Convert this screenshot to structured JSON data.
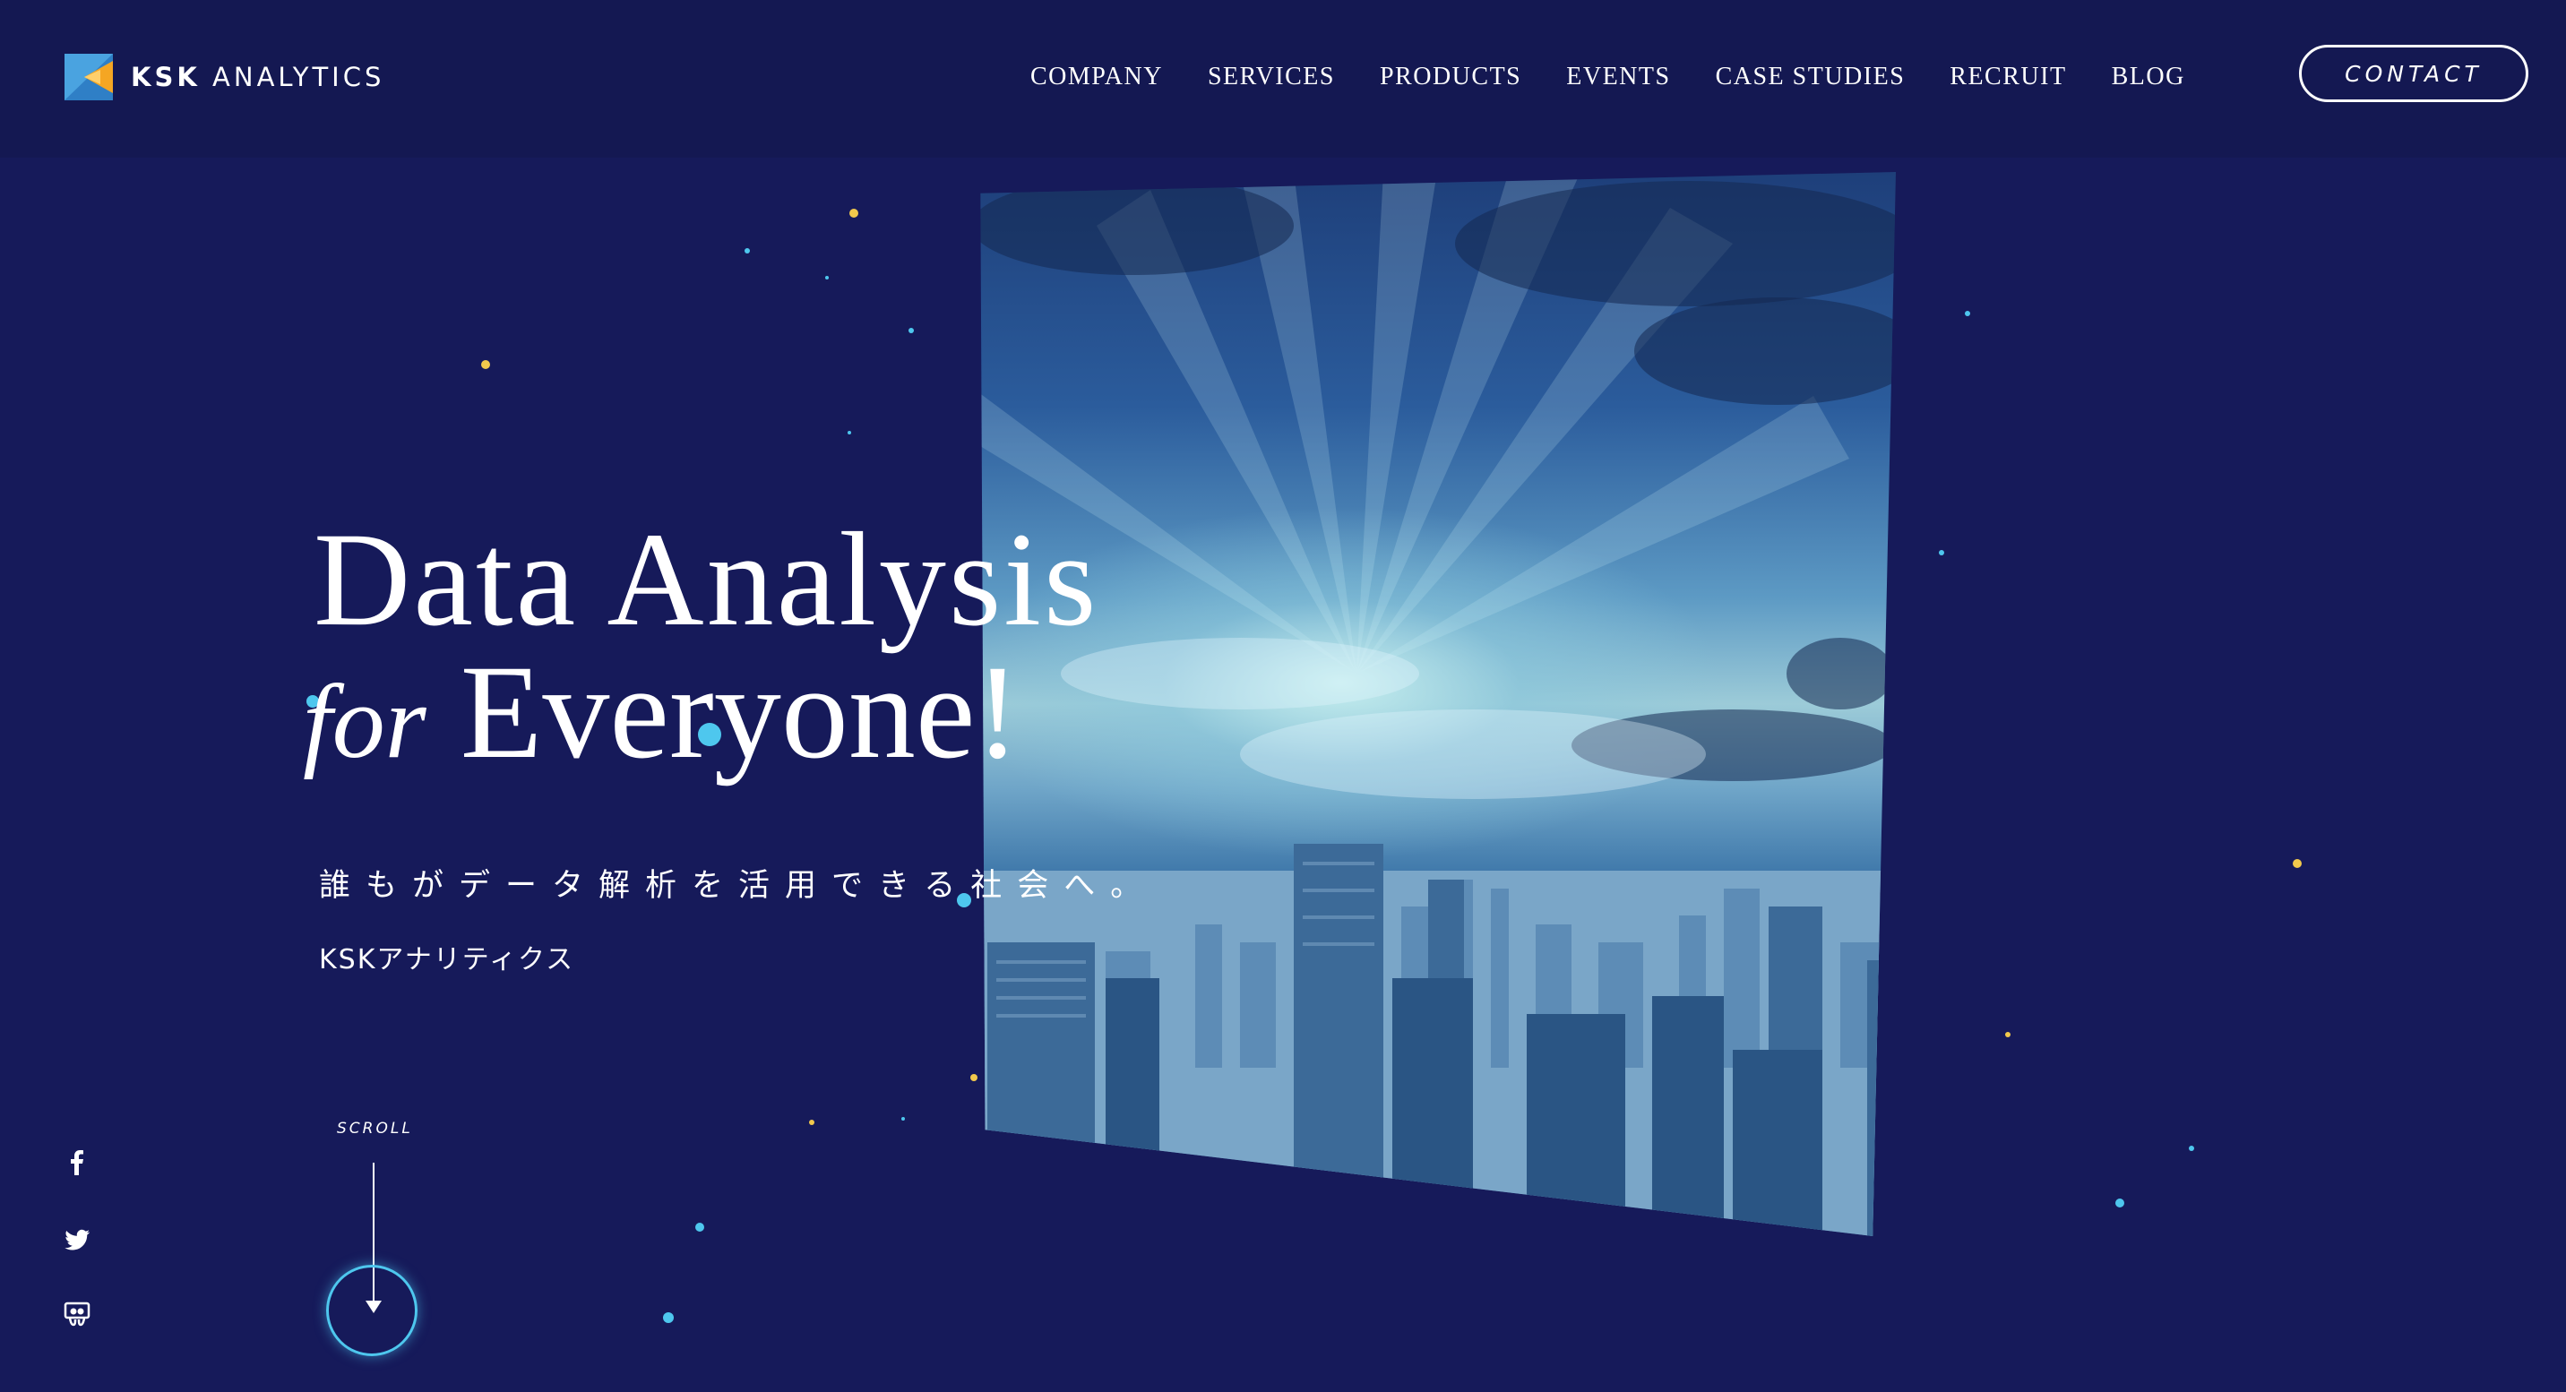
{
  "brand": {
    "name_bold": "KSK",
    "name_rest": " ANALYTICS"
  },
  "nav": {
    "items": [
      {
        "label": "COMPANY"
      },
      {
        "label": "SERVICES"
      },
      {
        "label": "PRODUCTS"
      },
      {
        "label": "EVENTS"
      },
      {
        "label": "CASE STUDIES"
      },
      {
        "label": "RECRUIT"
      },
      {
        "label": "BLOG"
      }
    ],
    "contact_label": "CONTACT"
  },
  "hero": {
    "line1": "Data Analysis",
    "line2_italic": "for",
    "line2_rest": "Everyone!",
    "subtitle_jp": "誰もがデータ解析を活用できる社会へ。",
    "company_jp": "KSKアナリティクス"
  },
  "scroll": {
    "label": "SCROLL"
  },
  "social": [
    {
      "icon": "facebook-icon"
    },
    {
      "icon": "twitter-icon"
    },
    {
      "icon": "slideshare-icon"
    }
  ],
  "colors": {
    "background": "#161a5a",
    "header": "#141852",
    "accent_cyan": "#4ec7ee",
    "particle_yellow": "#f2c94c",
    "logo_orange": "#f5a623",
    "logo_blue": "#2f7fc6"
  }
}
